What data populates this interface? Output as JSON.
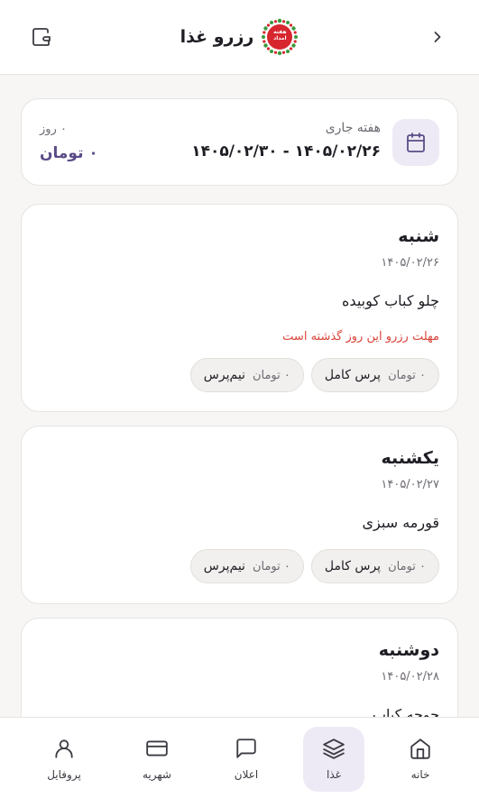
{
  "header": {
    "title": "رزرو غذا",
    "logo_text": "هفته امداد"
  },
  "week": {
    "label": "هفته جاری",
    "range": "۱۴۰۵/۰۲/۲۶ - ۱۴۰۵/۰۲/۳۰",
    "days": "۰ روز",
    "total_price": "۰ تومان"
  },
  "days": [
    {
      "name": "شنبه",
      "date": "۱۴۰۵/۰۲/۲۶",
      "meal": "چلو کباب کوبیده",
      "deadline": "مهلت رزرو این روز گذشته است",
      "options": [
        {
          "name": "پرس کامل",
          "price": "۰ تومان"
        },
        {
          "name": "نیم‌پرس",
          "price": "۰ تومان"
        }
      ]
    },
    {
      "name": "یکشنبه",
      "date": "۱۴۰۵/۰۲/۲۷",
      "meal": "قورمه سبزی",
      "options": [
        {
          "name": "پرس کامل",
          "price": "۰ تومان"
        },
        {
          "name": "نیم‌پرس",
          "price": "۰ تومان"
        }
      ]
    },
    {
      "name": "دوشنبه",
      "date": "۱۴۰۵/۰۲/۲۸",
      "meal": "جوجه کباب"
    }
  ],
  "tabs": [
    {
      "label": "خانه",
      "icon": "home-icon"
    },
    {
      "label": "غذا",
      "icon": "layers-icon",
      "active": true
    },
    {
      "label": "اعلان",
      "icon": "chat-icon"
    },
    {
      "label": "شهریه",
      "icon": "card-icon"
    },
    {
      "label": "پروفایل",
      "icon": "user-icon"
    }
  ],
  "colors": {
    "accent": "#5b4c87",
    "accent_bg": "#eeeaf5",
    "danger": "#d9443a",
    "logo_red": "#d7262e",
    "logo_green": "#3a9a3e"
  }
}
